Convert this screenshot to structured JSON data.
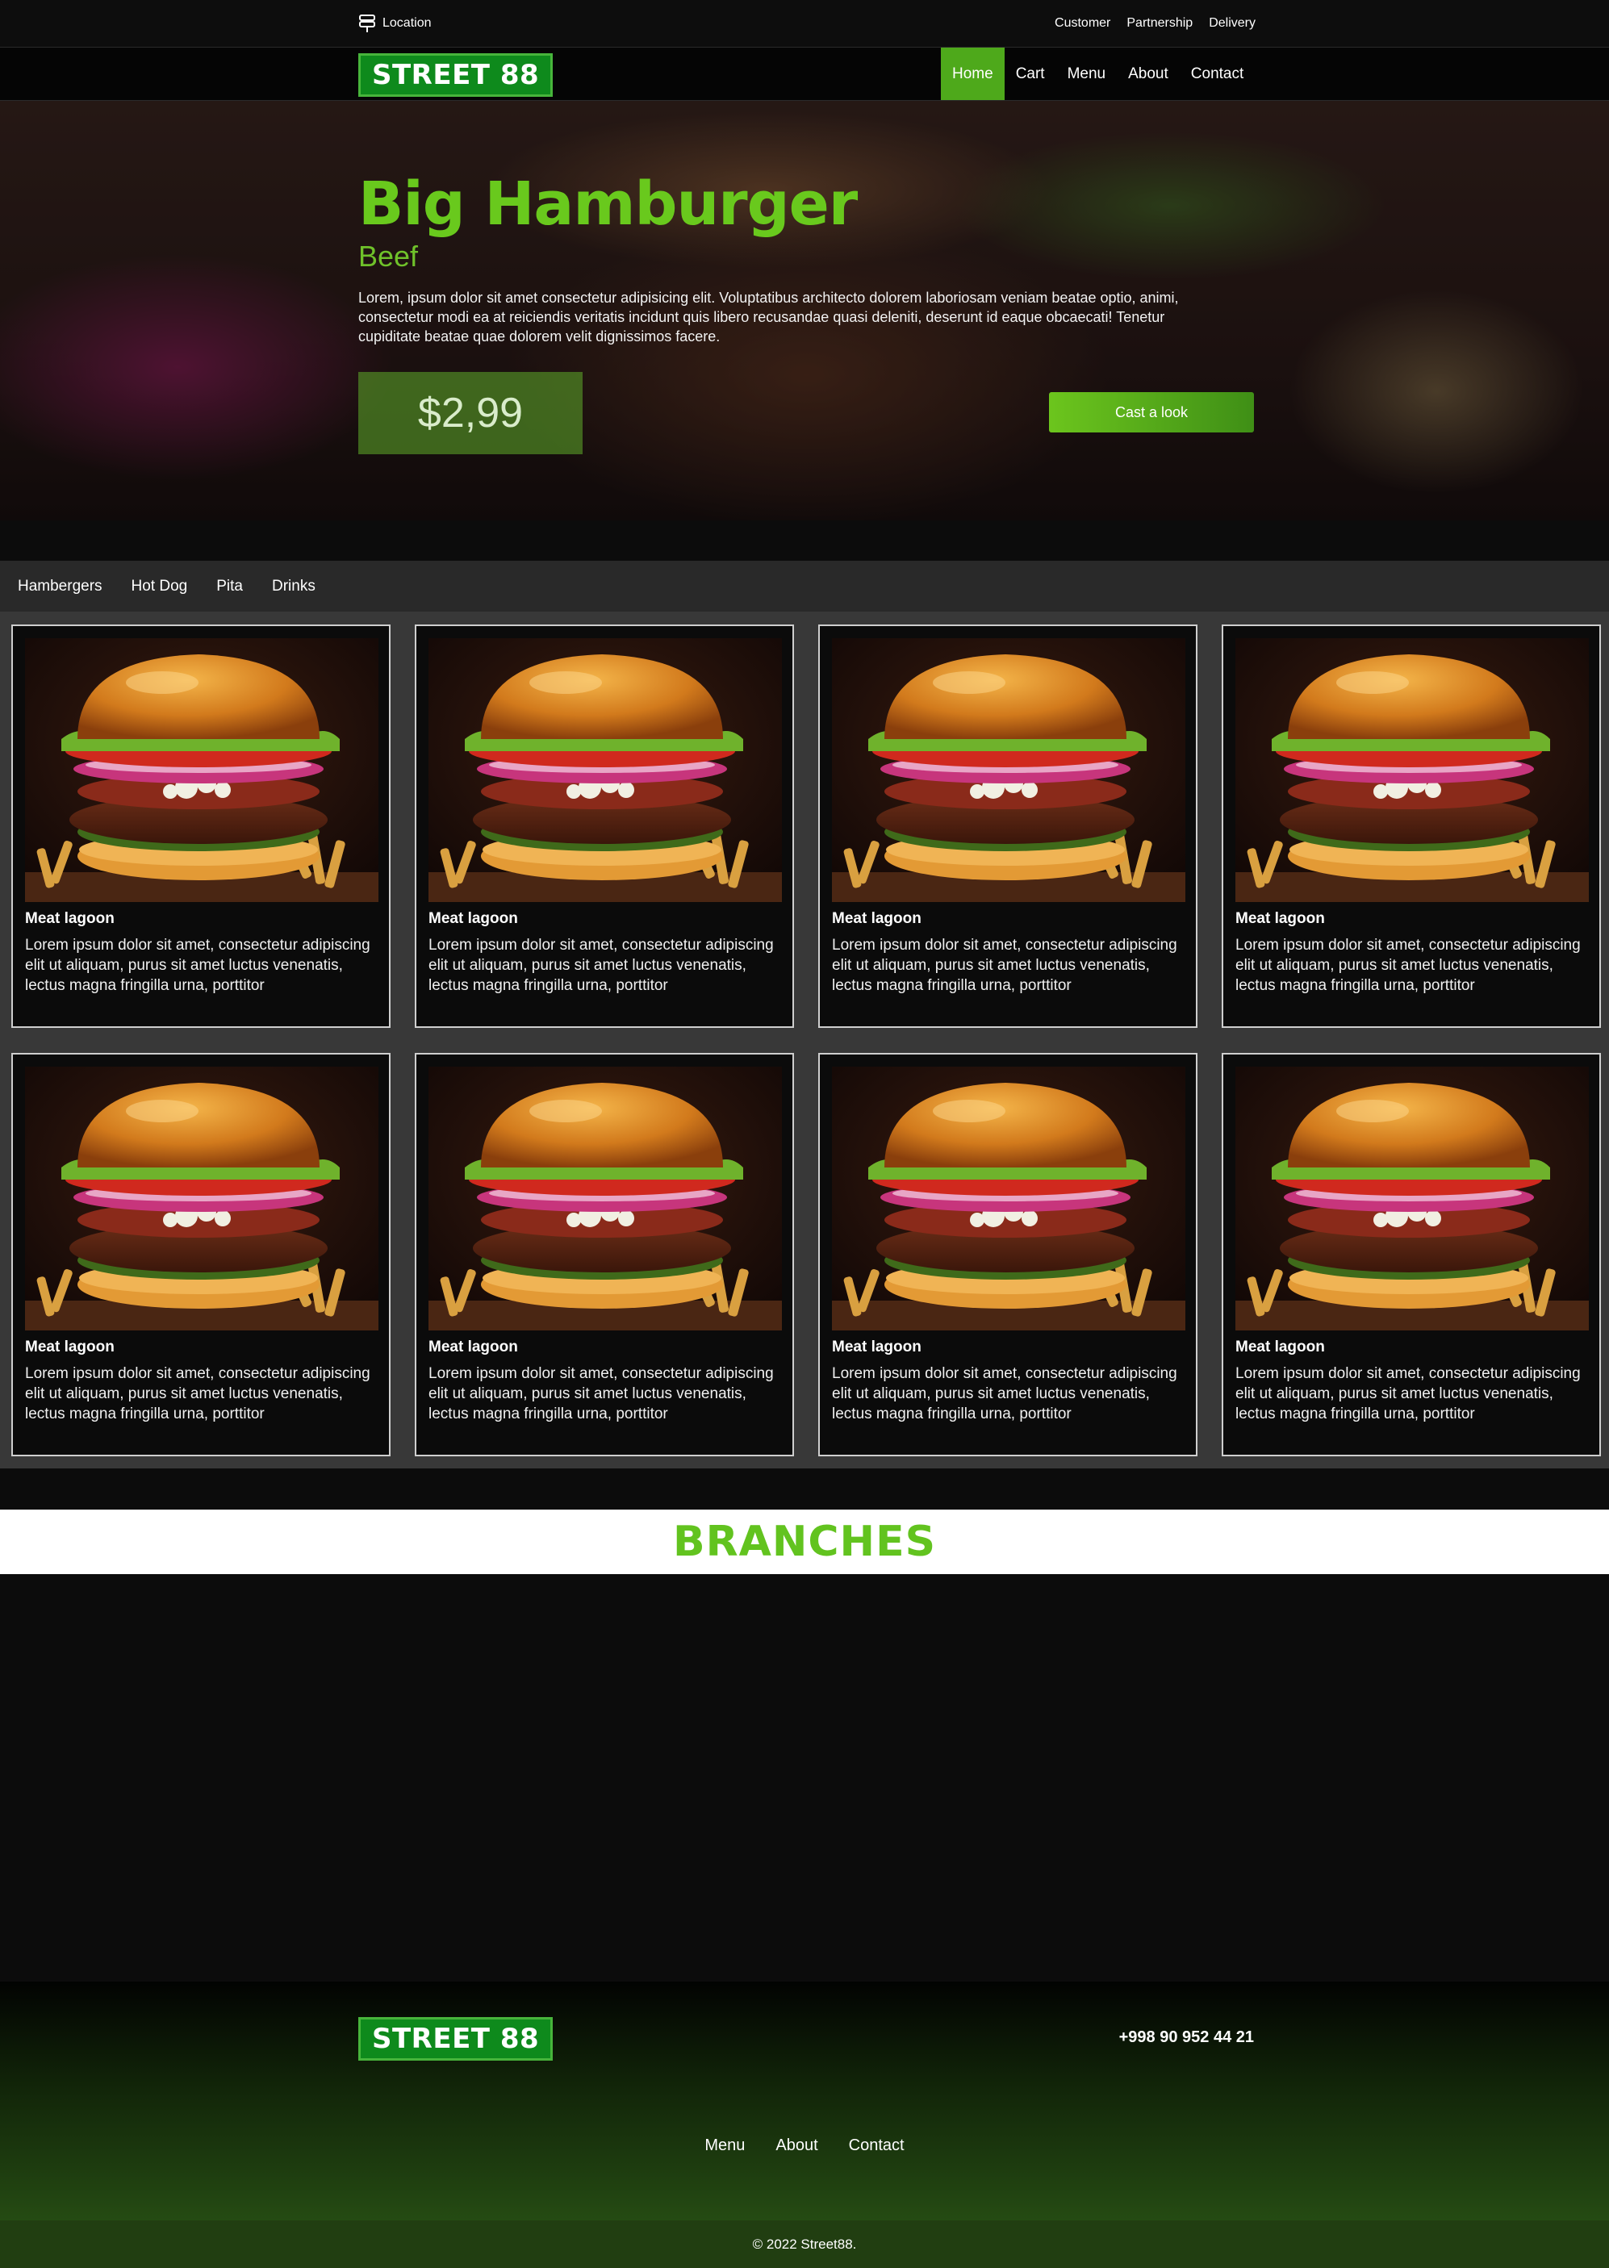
{
  "topbar": {
    "location_label": "Location",
    "links": [
      "Customer",
      "Partnership",
      "Delivery"
    ]
  },
  "brand": {
    "logo": "STREET 88"
  },
  "nav": {
    "items": [
      "Home",
      "Cart",
      "Menu",
      "About",
      "Contact"
    ],
    "active": "Home"
  },
  "hero": {
    "title": "Big Hamburger",
    "subtitle": "Beef",
    "description": "Lorem, ipsum dolor sit amet consectetur adipisicing elit. Voluptatibus architecto dolorem laboriosam veniam beatae optio, animi, consectetur modi ea at reiciendis veritatis incidunt quis libero recusandae quasi deleniti, deserunt id eaque obcaecati! Tenetur cupiditate beatae quae dolorem velit dignissimos facere.",
    "price": "$2,99",
    "cta": "Cast a look"
  },
  "categories": [
    "Hambergers",
    "Hot Dog",
    "Pita",
    "Drinks"
  ],
  "products": [
    {
      "title": "Meat lagoon",
      "description": "Lorem ipsum dolor sit amet, consectetur adipiscing elit ut aliquam, purus sit amet luctus venenatis, lectus magna fringilla urna, porttitor"
    },
    {
      "title": "Meat lagoon",
      "description": "Lorem ipsum dolor sit amet, consectetur adipiscing elit ut aliquam, purus sit amet luctus venenatis, lectus magna fringilla urna, porttitor"
    },
    {
      "title": "Meat lagoon",
      "description": "Lorem ipsum dolor sit amet, consectetur adipiscing elit ut aliquam, purus sit amet luctus venenatis, lectus magna fringilla urna, porttitor"
    },
    {
      "title": "Meat lagoon",
      "description": "Lorem ipsum dolor sit amet, consectetur adipiscing elit ut aliquam, purus sit amet luctus venenatis, lectus magna fringilla urna, porttitor"
    },
    {
      "title": "Meat lagoon",
      "description": "Lorem ipsum dolor sit amet, consectetur adipiscing elit ut aliquam, purus sit amet luctus venenatis, lectus magna fringilla urna, porttitor"
    },
    {
      "title": "Meat lagoon",
      "description": "Lorem ipsum dolor sit amet, consectetur adipiscing elit ut aliquam, purus sit amet luctus venenatis, lectus magna fringilla urna, porttitor"
    },
    {
      "title": "Meat lagoon",
      "description": "Lorem ipsum dolor sit amet, consectetur adipiscing elit ut aliquam, purus sit amet luctus venenatis, lectus magna fringilla urna, porttitor"
    },
    {
      "title": "Meat lagoon",
      "description": "Lorem ipsum dolor sit amet, consectetur adipiscing elit ut aliquam, purus sit amet luctus venenatis, lectus magna fringilla urna, porttitor"
    }
  ],
  "branches": {
    "title": "BRANCHES"
  },
  "footer": {
    "phone": "+998 90 952 44 21",
    "nav": [
      "Menu",
      "About",
      "Contact"
    ],
    "copyright": "© 2022 Street88."
  },
  "colors": {
    "accent": "#69c91d",
    "nav_active": "#4ea91b",
    "logo_bg": "#0e8a1c",
    "footer_bottom": "#213e11"
  }
}
